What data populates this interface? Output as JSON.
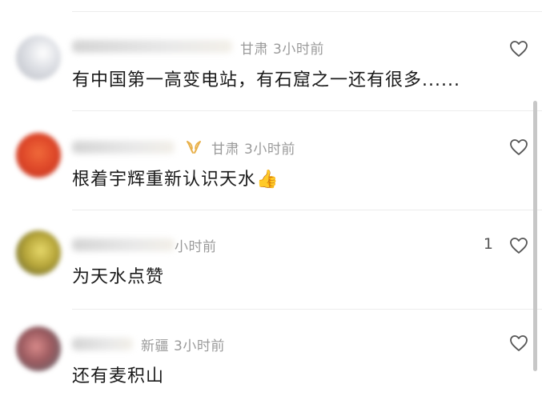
{
  "comments": [
    {
      "location": "甘肃",
      "time": "3小时前",
      "text": "有中国第一高变电站，有石窟之一还有很多......",
      "likes": "",
      "avatar_color": "#c9ccd4",
      "liked_icon": "heart-outline-icon"
    },
    {
      "location": "甘肃",
      "time": "3小时前",
      "text": "根着宇辉重新认识天水",
      "emoji": "👍",
      "likes": "",
      "avatar_color": "#e04a2a",
      "badge_icon": "laurel-badge-icon",
      "liked_icon": "heart-outline-icon"
    },
    {
      "location": "",
      "time": "小时前",
      "text": "为天水点赞",
      "likes": "1",
      "avatar_color": "#b7a63a",
      "liked_icon": "heart-outline-icon"
    },
    {
      "location": "新疆",
      "time": "3小时前",
      "text": "还有麦积山",
      "likes": "",
      "avatar_color": "#9b5a5f",
      "liked_icon": "heart-outline-icon"
    }
  ],
  "colors": {
    "meta_text": "#9a9a9a",
    "comment_text": "#1a1a1a",
    "badge": "#e8b04a"
  }
}
